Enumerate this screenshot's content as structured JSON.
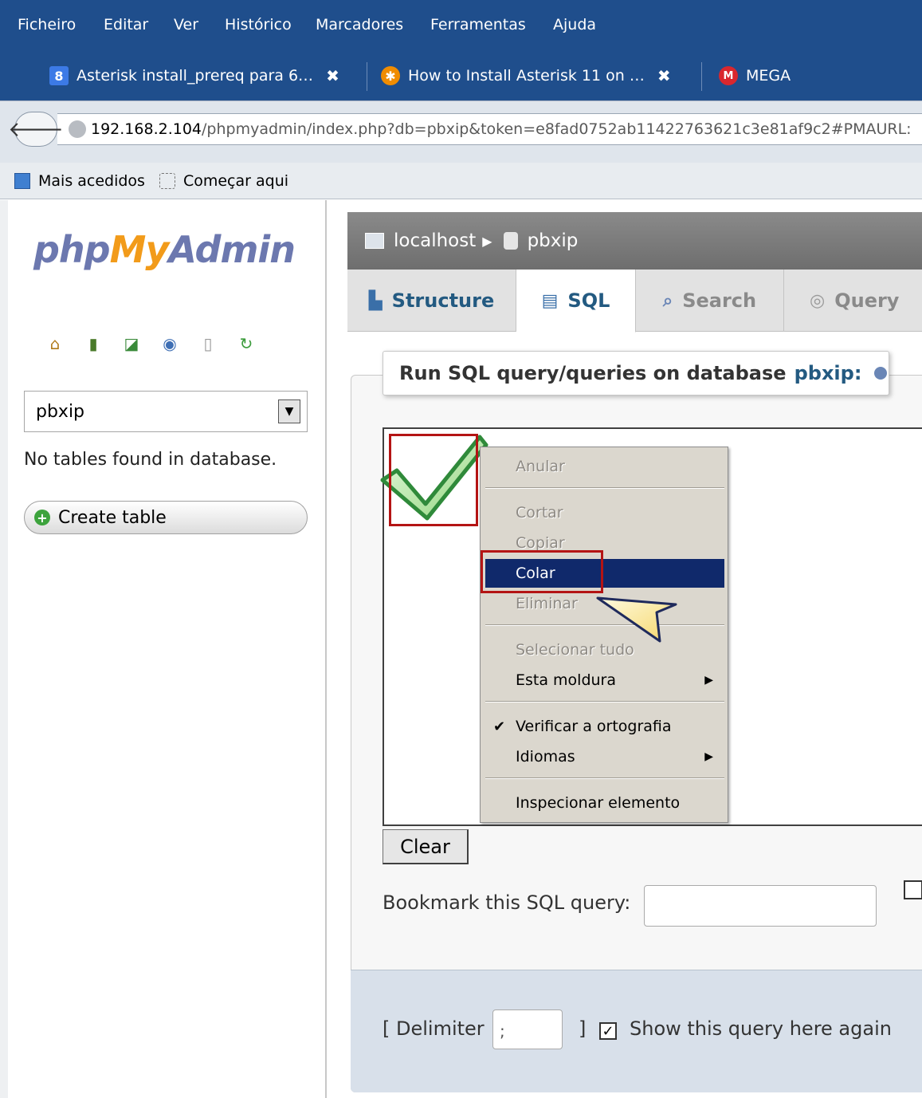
{
  "browser": {
    "menu": [
      "Ficheiro",
      "Editar",
      "Ver",
      "Histórico",
      "Marcadores",
      "Ferramentas",
      "Ajuda"
    ],
    "tabs": [
      {
        "label": "Asterisk install_prereq para 6…",
        "close": "✖",
        "icon": "google-icon",
        "color": "#3c7ae6"
      },
      {
        "label": "How to Install Asterisk 11 on …",
        "close": "✖",
        "icon": "asterisk-icon",
        "color": "#f08c00"
      },
      {
        "label": "MEGA",
        "icon": "mega-icon",
        "color": "#d9272e"
      }
    ],
    "url_host": "192.168.2.104",
    "url_path": "/phpmyadmin/index.php?db=pbxip&token=e8fad0752ab11422763621c3e81af9c2#PMAURL:",
    "bookmarks": [
      "Mais acedidos",
      "Começar aqui"
    ]
  },
  "sidebar": {
    "logo": {
      "php": "php",
      "my": "My",
      "admin": "Admin"
    },
    "icons": [
      "home-icon",
      "exit-icon",
      "sql-icon",
      "help-icon",
      "docs-icon",
      "reload-icon"
    ],
    "db_selected": "pbxip",
    "no_tables": "No tables found in database.",
    "create_table": "Create table"
  },
  "breadcrumb": {
    "server": "localhost",
    "db": "pbxip"
  },
  "tabs": {
    "structure": "Structure",
    "sql": "SQL",
    "search": "Search",
    "query": "Query"
  },
  "sql_panel": {
    "legend_prefix": "Run SQL query/queries on database",
    "legend_db": "pbxip:",
    "clear": "Clear",
    "bookmark_label": "Bookmark this SQL query:",
    "delimiter_label": "[ Delimiter",
    "delimiter_value": ";",
    "delimiter_close": "]",
    "show_query_label": "Show this query here again",
    "show_query_checked": "✓"
  },
  "context_menu": {
    "undo": "Anular",
    "cut": "Cortar",
    "copy": "Copiar",
    "paste": "Colar",
    "delete": "Eliminar",
    "select_all": "Selecionar tudo",
    "this_frame": "Esta moldura",
    "spellcheck": "Verificar a ortografia",
    "languages": "Idiomas",
    "inspect": "Inspecionar elemento",
    "check_mark": "✔",
    "submenu_arrow": "▶"
  },
  "colors": {
    "highlight": "#b41414",
    "menu_active": "#10296b",
    "pma_link": "#235a81"
  }
}
